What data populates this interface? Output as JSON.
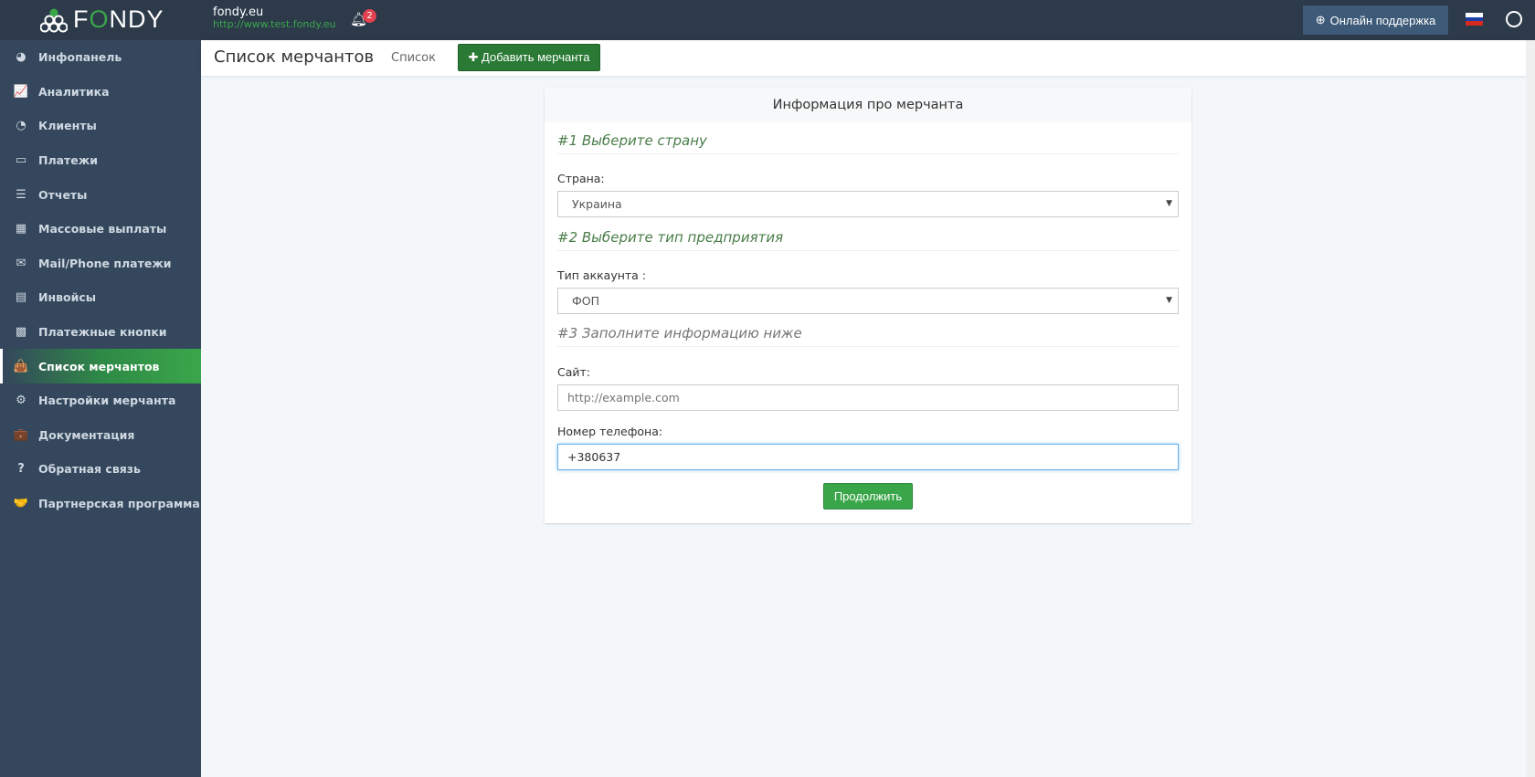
{
  "header": {
    "brand": "FONDY",
    "site_name": "fondy.eu",
    "site_url": "http://www.test.fondy.eu",
    "notifications": "2",
    "support_label": "Онлайн поддержка",
    "language_flag": "ru"
  },
  "sidebar": {
    "items": [
      {
        "label": "Инфопанель",
        "icon": "dashboard-icon",
        "glyph": "◕"
      },
      {
        "label": "Аналитика",
        "icon": "line-chart-icon",
        "glyph": "📈"
      },
      {
        "label": "Клиенты",
        "icon": "pie-chart-icon",
        "glyph": "◔"
      },
      {
        "label": "Платежи",
        "icon": "credit-card-icon",
        "glyph": "▭"
      },
      {
        "label": "Отчеты",
        "icon": "server-icon",
        "glyph": "☰"
      },
      {
        "label": "Массовые выплаты",
        "icon": "grid-icon",
        "glyph": "▦"
      },
      {
        "label": "Mail/Phone платежи",
        "icon": "envelope-icon",
        "glyph": "✉"
      },
      {
        "label": "Инвойсы",
        "icon": "file-icon",
        "glyph": "▤"
      },
      {
        "label": "Платежные кнопки",
        "icon": "qrcode-icon",
        "glyph": "▩"
      },
      {
        "label": "Список мерчантов",
        "icon": "shopping-bag-icon",
        "glyph": "👜",
        "active": true
      },
      {
        "label": "Настройки мерчанта",
        "icon": "gears-icon",
        "glyph": "⚙"
      },
      {
        "label": "Документация",
        "icon": "briefcase-icon",
        "glyph": "💼"
      },
      {
        "label": "Обратная связь",
        "icon": "question-circle-icon",
        "glyph": "?"
      },
      {
        "label": "Партнерская программа",
        "icon": "handshake-icon",
        "glyph": "🤝"
      }
    ]
  },
  "page": {
    "title": "Список мерчантов",
    "list_link": "Список",
    "add_button": "Добавить мерчанта"
  },
  "form": {
    "title": "Информация про мерчанта",
    "step1": "#1 Выберите страну",
    "country_label": "Страна:",
    "country_value": "Украина",
    "step2": "#2 Выберите тип предприятия",
    "account_label": "Тип аккаунта :",
    "account_value": "ФОП",
    "step3": "#3 Заполните информацию ниже",
    "site_label": "Сайт:",
    "site_placeholder": "http://example.com",
    "phone_label": "Номер телефона:",
    "phone_value": "+380637",
    "continue": "Продолжить"
  },
  "colors": {
    "accent": "#3aa64a",
    "topbar": "#2c3a4a",
    "sidebar": "#34475c"
  }
}
